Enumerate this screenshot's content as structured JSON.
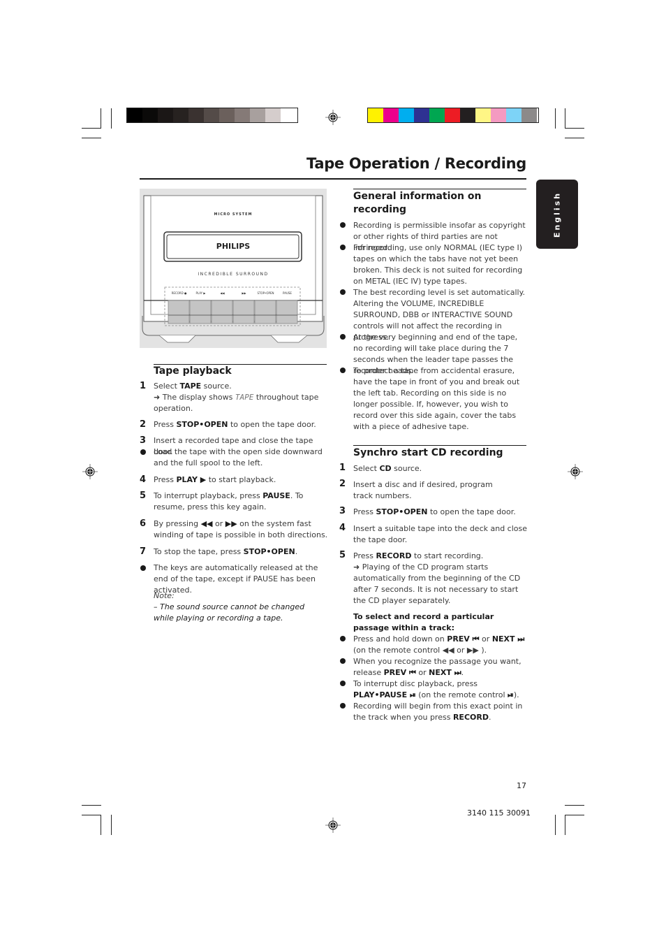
{
  "header": {
    "title": "Tape Operation / Recording",
    "language_tab": "English",
    "grayscale_bar": [
      "#000000",
      "#0b0a09",
      "#1b1716",
      "#272220",
      "#3a3230",
      "#544b48",
      "#6b605c",
      "#857a77",
      "#a8a09e",
      "#d5cdcc",
      "#ffffff"
    ],
    "color_bar": [
      "#fff200",
      "#ec008c",
      "#00aeef",
      "#2e3192",
      "#00a651",
      "#ed1c24",
      "#231f20",
      "#fff685",
      "#f49ac1",
      "#7dd3f7",
      "#8c8a8a"
    ]
  },
  "illustration": {
    "label_top": "MICRO SYSTEM",
    "brand": "PHILIPS",
    "label_surround": "INCREDIBLE SURROUND",
    "buttons": [
      "RECORD ●",
      "PLAY ▶",
      "◀◀",
      "▶▶",
      "STOP•OPEN",
      "PAUSE"
    ]
  },
  "tape_playback": {
    "heading": "Tape playback",
    "steps": [
      {
        "num": "1",
        "pre": "Select ",
        "bold": "TAPE",
        "post": " source.",
        "extra_arrow": "➜ The display shows ",
        "extra_display": "TAPE",
        "extra_post": " throughout tape operation."
      },
      {
        "num": "2",
        "pre": "Press ",
        "bold": "STOP•OPEN",
        "post": " to open the tape door."
      },
      {
        "num": "3",
        "text": "Insert a recorded tape and close the tape door."
      },
      {
        "bullet": true,
        "text": "Load the tape with the open side downward and the full spool to the left."
      },
      {
        "num": "4",
        "pre": "Press ",
        "bold": "PLAY ▶",
        "post": " to start playback."
      },
      {
        "num": "5",
        "pre": "To interrupt playback, press ",
        "bold": "PAUSE",
        "post": ". To resume, press this key again."
      },
      {
        "num": "6",
        "pre": "By pressing ",
        "sym1": "◀◀",
        "mid": " or ",
        "sym2": "▶▶",
        "post": " on the system fast winding of tape is possible in both directions."
      },
      {
        "num": "7",
        "pre": "To stop the tape, press ",
        "bold": "STOP•OPEN",
        "post": "."
      },
      {
        "bullet": true,
        "text": "The keys are automatically released at the end of the tape, except if PAUSE has been activated."
      }
    ],
    "note_label": "Note:",
    "note_text": "–  The sound source cannot be changed while playing or recording a tape."
  },
  "general_info": {
    "heading": "General information on recording",
    "bullets": [
      "Recording is permissible insofar as copyright or other rights of third parties are not infringed.",
      "For recording, use only NORMAL (IEC type I) tapes on which the tabs have not yet been broken. This deck is not suited for recording on METAL (IEC IV) type tapes.",
      "The best recording level is set automatically. Altering the VOLUME, INCREDIBLE SURROUND, DBB or INTERACTIVE SOUND controls will not affect the recording in progress.",
      "At the very beginning and end of the tape, no recording will take place during the 7 seconds when the leader tape passes the recorder heads.",
      "To protect a tape from accidental erasure, have the tape in front of you and break out the left tab. Recording on this side is no longer possible. If, however, you wish to record over this side again, cover the tabs with a piece of adhesive tape."
    ]
  },
  "synchro": {
    "heading": "Synchro start CD recording",
    "steps": [
      {
        "num": "1",
        "pre": "Select ",
        "bold": "CD",
        "post": " source."
      },
      {
        "num": "2",
        "text": "Insert a disc and if desired, program track numbers."
      },
      {
        "num": "3",
        "pre": "Press ",
        "bold": "STOP•OPEN",
        "post": " to open the tape door."
      },
      {
        "num": "4",
        "text": "Insert a suitable tape into the deck and close the tape door."
      },
      {
        "num": "5",
        "pre": "Press ",
        "bold": "RECORD",
        "post": " to start recording.",
        "extra": "➜ Playing of the CD program starts automatically from the beginning of the CD after 7 seconds. It is not necessary to start the CD player separately."
      }
    ],
    "subheading": "To select and record a particular passage within a track:",
    "bullets": [
      {
        "a": "Press and hold down on ",
        "b1": "PREV ⏮",
        "c": " or ",
        "b2": "NEXT ⏭",
        "d": " (on the remote control ◀◀ or ▶▶ )."
      },
      {
        "a": "When you recognize the passage you want, release ",
        "b1": "PREV ⏮",
        "c": " or ",
        "b2": "NEXT ⏭",
        "d": "."
      },
      {
        "a": "To interrupt disc playback, press ",
        "b1": "PLAY•PAUSE ⏯",
        "c": " (on the remote control ",
        "b2": "⏯",
        "d": ")."
      },
      {
        "a": "Recording will begin from this exact point in the track when you press ",
        "b1": "RECORD",
        "c": ".",
        "b2": "",
        "d": ""
      }
    ]
  },
  "footer": {
    "page_number": "17",
    "doc_code": "3140 115 30091"
  }
}
